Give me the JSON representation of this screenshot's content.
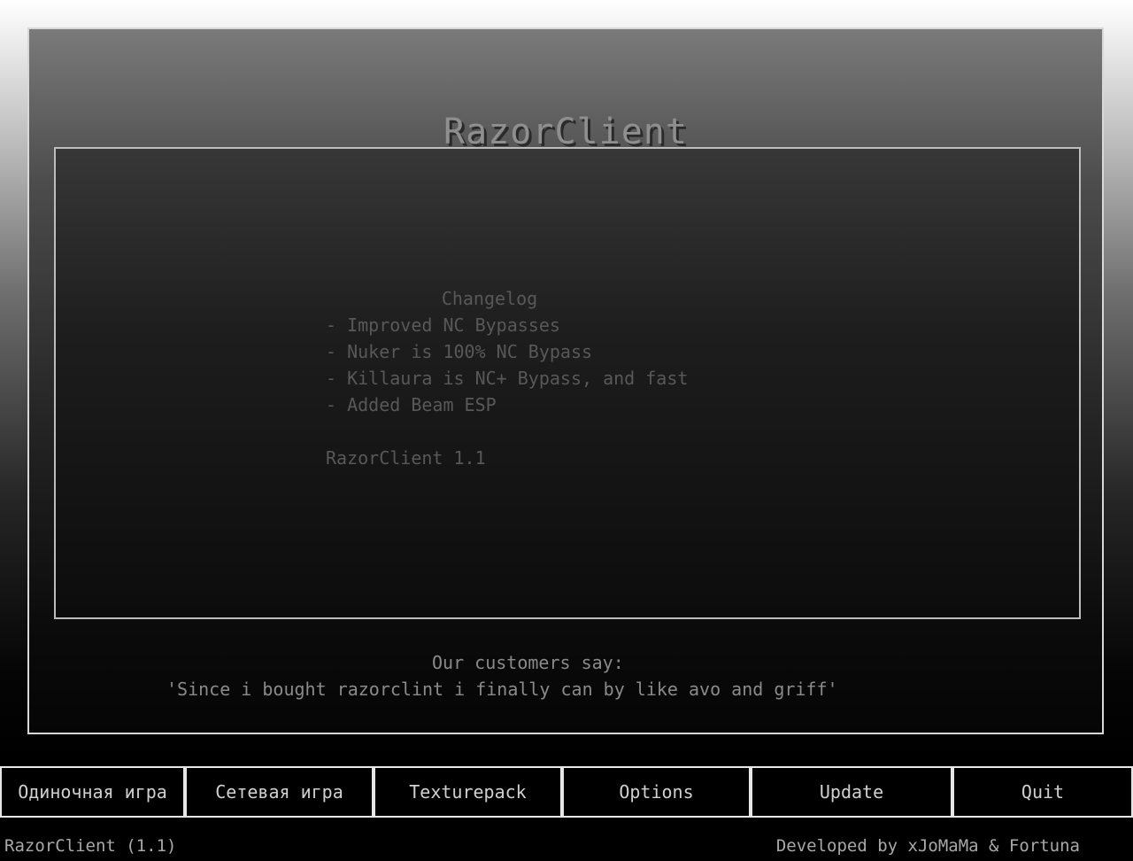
{
  "app": {
    "title": "RazorClient"
  },
  "changelog": {
    "heading": "Changelog",
    "lines": [
      "- Improved NC Bypasses",
      "- Nuker is 100% NC Bypass",
      "- Killaura is NC+ Bypass, and fast",
      "- Added Beam ESP"
    ],
    "version_line": "RazorClient 1.1"
  },
  "testimonial": {
    "heading": "Our customers say:",
    "quote": "'Since i bought razorclint i finally can by like avo and griff'"
  },
  "menu": {
    "buttons": [
      {
        "label": "Одиночная игра"
      },
      {
        "label": "Сетевая игра"
      },
      {
        "label": "Texturepack"
      },
      {
        "label": "Options"
      },
      {
        "label": "Update"
      },
      {
        "label": "Quit"
      }
    ]
  },
  "footer": {
    "left": "RazorClient (1.1)",
    "right": "Developed by xJoMaMa & Fortuna"
  },
  "colors": {
    "panel_border": "#d8d8d8",
    "button_border": "#e6e6e6",
    "title_text": "#8f8f8f"
  }
}
